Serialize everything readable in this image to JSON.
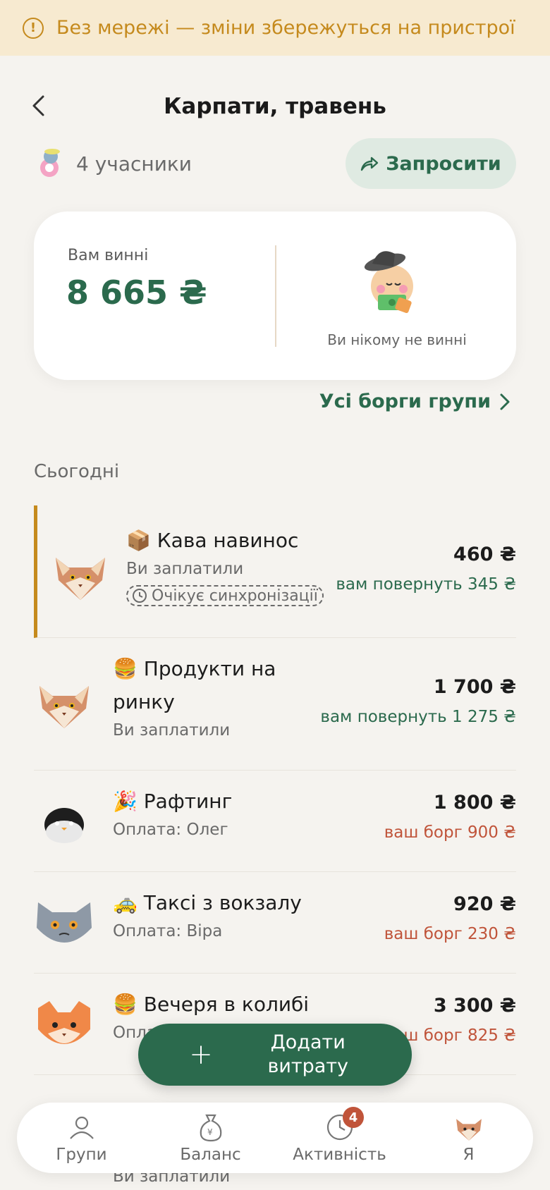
{
  "offline_banner": {
    "text": "Без мережі — зміни збережуться на пристрої"
  },
  "header": {
    "title": "Карпати, травень"
  },
  "members": {
    "count_label": "4 учасники",
    "invite_label": "Запросити"
  },
  "balance": {
    "owed_label": "Вам винні",
    "owed_amount": "8 665 ₴",
    "no_debt_label": "Ви нікому не винні"
  },
  "all_debts_link": "Усі борги групи",
  "section_today": "Сьогодні",
  "expenses": [
    {
      "emoji": "📦",
      "title": "Кава навинос",
      "payer": "Ви заплатили",
      "amount": "460 ₴",
      "delta": "вам повернуть 345 ₴",
      "delta_type": "credit",
      "sync": "Очікує синхронізації",
      "avatar": "cat-brown-icon"
    },
    {
      "emoji": "🍔",
      "title": "Продукти на ринку",
      "payer": "Ви заплатили",
      "amount": "1 700 ₴",
      "delta": "вам повернуть 1 275 ₴",
      "delta_type": "credit",
      "avatar": "cat-brown-icon"
    },
    {
      "emoji": "🎉",
      "title": "Рафтинг",
      "payer": "Оплата: Олег",
      "amount": "1 800 ₴",
      "delta": "ваш борг 900 ₴",
      "delta_type": "debt",
      "avatar": "penguin-icon"
    },
    {
      "emoji": "🚕",
      "title": "Таксі з вокзалу",
      "payer": "Оплата: Віра",
      "amount": "920 ₴",
      "delta": "ваш борг 230 ₴",
      "delta_type": "debt",
      "avatar": "cat-grey-icon"
    },
    {
      "emoji": "🍔",
      "title": "Вечеря в колибі",
      "payer": "Опла",
      "amount": "3 300 ₴",
      "delta": "ваш борг 825 ₴",
      "delta_type": "debt",
      "avatar": "cat-orange-icon"
    }
  ],
  "fab": {
    "label": "Додати витрату"
  },
  "bottom_nav": [
    {
      "label": "Групи",
      "icon": "people-icon"
    },
    {
      "label": "Баланс",
      "icon": "money-bag-icon"
    },
    {
      "label": "Активність",
      "icon": "clock-icon",
      "badge": "4"
    },
    {
      "label": "Я",
      "icon": "profile-cat-icon"
    }
  ],
  "peek_row_payer": "Ви заплатили",
  "colors": {
    "accent": "#2b6a4d",
    "warning": "#c58a1d",
    "debt": "#c0543a",
    "background": "#f5f3ef"
  }
}
